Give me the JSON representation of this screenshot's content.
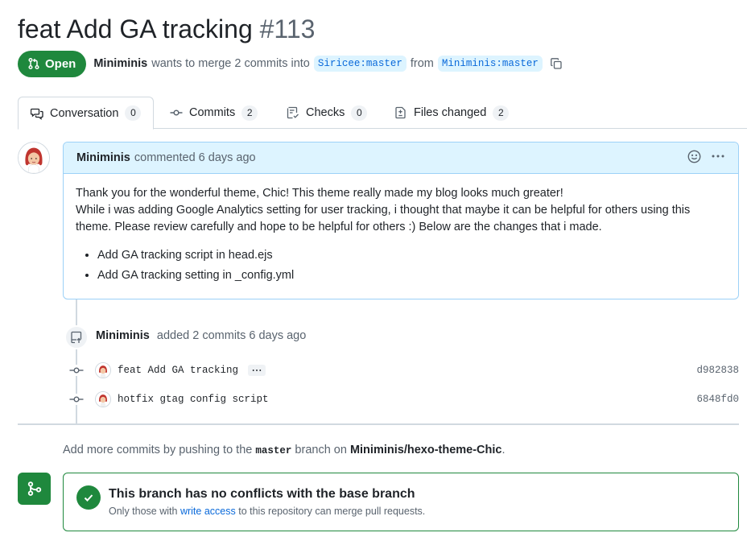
{
  "pr": {
    "title": "feat Add GA tracking",
    "number": "#113",
    "state": "Open",
    "author": "Miniminis",
    "merge_text": "wants to merge 2 commits into",
    "base_branch": "Siricee:master",
    "from_text": "from",
    "head_branch": "Miniminis:master"
  },
  "tabs": [
    {
      "label": "Conversation",
      "count": "0",
      "icon": "comment-discussion-icon"
    },
    {
      "label": "Commits",
      "count": "2",
      "icon": "git-commit-icon"
    },
    {
      "label": "Checks",
      "count": "0",
      "icon": "checklist-icon"
    },
    {
      "label": "Files changed",
      "count": "2",
      "icon": "file-diff-icon"
    }
  ],
  "comment": {
    "author": "Miniminis",
    "meta": "commented 6 days ago",
    "p1": "Thank you for the wonderful theme, Chic! This theme really made my blog looks much greater!",
    "p2": "While i was adding Google Analytics setting for user tracking, i thought that maybe it can be helpful for others using this theme. Please review carefully and hope to be helpful for others :) Below are the changes that i made.",
    "items": [
      "Add GA tracking script in head.ejs",
      "Add GA tracking setting in _config.yml"
    ]
  },
  "commit_event": {
    "author": "Miniminis",
    "text": "added 2 commits 6 days ago"
  },
  "commits": [
    {
      "message": "feat Add GA tracking",
      "sha": "d982838",
      "has_more": true
    },
    {
      "message": "hotfix gtag config script",
      "sha": "6848fd0",
      "has_more": false
    }
  ],
  "hint": {
    "prefix": "Add more commits by pushing to the",
    "branch": "master",
    "middle": "branch on",
    "repo": "Miniminis/hexo-theme-Chic",
    "suffix": "."
  },
  "merge": {
    "title": "This branch has no conflicts with the base branch",
    "sub_prefix": "Only those with",
    "sub_link": "write access",
    "sub_suffix": "to this repository can merge pull requests."
  },
  "colors": {
    "open_green": "#1f883d",
    "link_blue": "#0969da",
    "comment_header_bg": "#ddf4ff",
    "comment_border": "#9cd1f7"
  }
}
